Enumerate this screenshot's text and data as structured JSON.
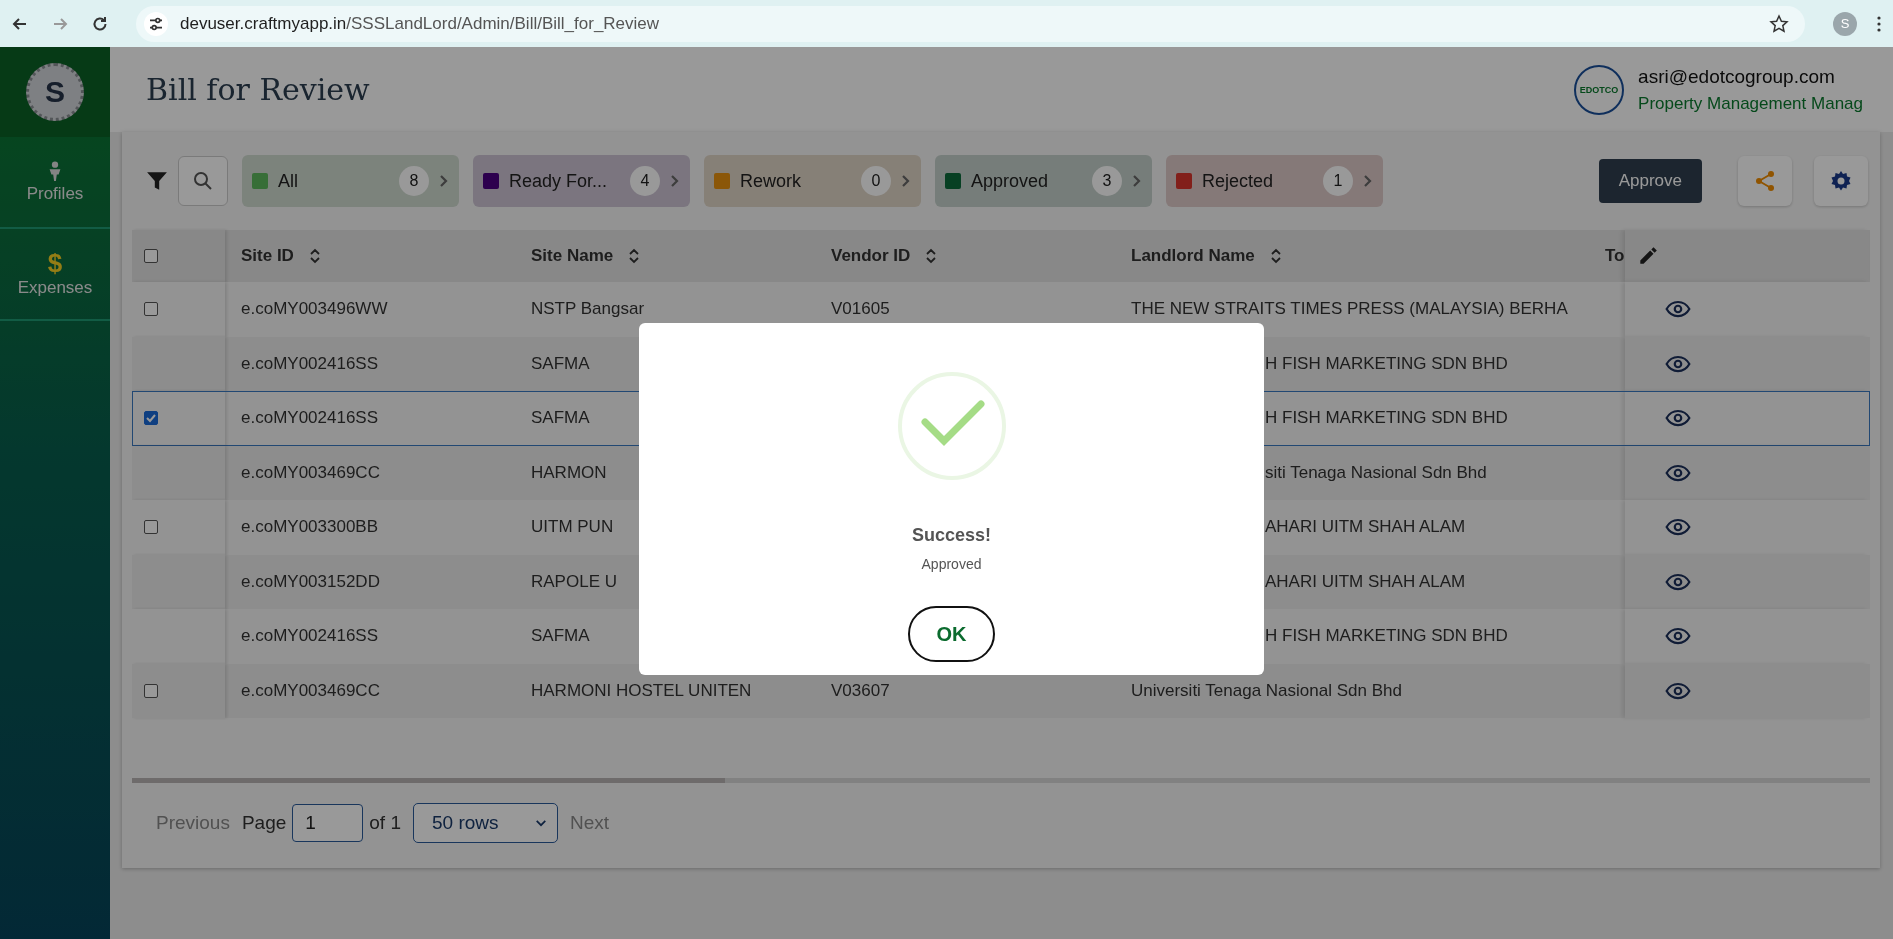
{
  "browser": {
    "url_host": "devuser.craftmyapp.in",
    "url_path": "/SSSLandLord/Admin/Bill/Bill_for_Review",
    "profile_initial": "S"
  },
  "sidebar": {
    "avatar_initial": "S",
    "items": [
      {
        "kind": "person",
        "label": "Profiles"
      },
      {
        "kind": "glyph",
        "glyph": "$",
        "label": "Expenses"
      }
    ]
  },
  "header": {
    "title": "Bill for Review",
    "logo_text": "EDOTCO",
    "email": "asri@edotcogroup.com",
    "role": "Property Management Manag"
  },
  "chips": [
    {
      "label": "All",
      "count": "8",
      "color": "#376e37"
    },
    {
      "label": "Ready For...",
      "count": "4",
      "color": "#2d004e"
    },
    {
      "label": "Rework",
      "count": "0",
      "color": "#8b5709"
    },
    {
      "label": "Approved",
      "count": "3",
      "color": "#074023"
    },
    {
      "label": "Rejected",
      "count": "1",
      "color": "#821f1a"
    }
  ],
  "approve_button": "Approve",
  "table": {
    "header_checked": false,
    "columns": [
      {
        "label": "Site ID",
        "sortable": true
      },
      {
        "label": "Site Name",
        "sortable": true
      },
      {
        "label": "Vendor ID",
        "sortable": true
      },
      {
        "label": "Landlord Name",
        "sortable": true
      },
      {
        "label": "To"
      }
    ],
    "rows": [
      {
        "kind": "checkbox",
        "checked": false,
        "selected": false,
        "site_id": "e.coMY003496WW",
        "site_name": "NSTP Bangsar",
        "vendor_id": "V01605",
        "landlord": "THE NEW STRAITS TIMES PRESS (MALAYSIA) BERHA"
      },
      {
        "kind": "plain",
        "selected": false,
        "site_id": "e.coMY002416SS",
        "site_name": "SAFMA",
        "landlord_tail": "H FISH MARKETING SDN BHD"
      },
      {
        "kind": "checkbox",
        "checked": true,
        "selected": true,
        "site_id": "e.coMY002416SS",
        "site_name": "SAFMA",
        "landlord_tail": "H FISH MARKETING SDN BHD"
      },
      {
        "kind": "plain",
        "selected": false,
        "site_id": "e.coMY003469CC",
        "site_name": "HARMON",
        "landlord_tail": "siti Tenaga Nasional Sdn Bhd"
      },
      {
        "kind": "checkbox",
        "checked": false,
        "selected": false,
        "site_id": "e.coMY003300BB",
        "site_name": "UITM PUN",
        "landlord_tail": "AHARI UITM SHAH ALAM"
      },
      {
        "kind": "plain",
        "selected": false,
        "site_id": "e.coMY003152DD",
        "site_name": "RAPOLE U",
        "landlord_tail": "AHARI UITM SHAH ALAM"
      },
      {
        "kind": "plain",
        "selected": false,
        "site_id": "e.coMY002416SS",
        "site_name": "SAFMA",
        "landlord_tail": "H FISH MARKETING SDN BHD"
      },
      {
        "kind": "checkbox",
        "checked": false,
        "selected": false,
        "site_id": "e.coMY003469CC",
        "site_name": "HARMONI HOSTEL UNITEN",
        "vendor_id": "V03607",
        "landlord": "Universiti Tenaga Nasional Sdn Bhd"
      }
    ]
  },
  "pagination": {
    "previous": "Previous",
    "page_label": "Page",
    "page": "1",
    "of": "of 1",
    "rows_option": "50 rows",
    "next": "Next"
  },
  "dialog": {
    "title": "Success!",
    "message": "Approved",
    "ok": "OK"
  }
}
